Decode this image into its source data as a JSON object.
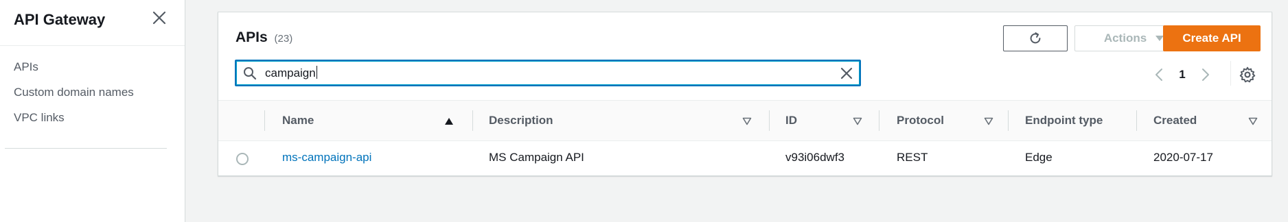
{
  "sidebar": {
    "title": "API Gateway",
    "items": [
      {
        "label": "APIs"
      },
      {
        "label": "Custom domain names"
      },
      {
        "label": "VPC links"
      }
    ]
  },
  "panel": {
    "title": "APIs",
    "count": "(23)",
    "actions_label": "Actions",
    "create_label": "Create API"
  },
  "search": {
    "value": "campaign"
  },
  "pagination": {
    "current_page": "1"
  },
  "table": {
    "columns": [
      {
        "label": "Name",
        "sort": "ascending"
      },
      {
        "label": "Description",
        "sort": "none"
      },
      {
        "label": "ID",
        "sort": "none"
      },
      {
        "label": "Protocol",
        "sort": "none"
      },
      {
        "label": "Endpoint type",
        "sort": "none"
      },
      {
        "label": "Created",
        "sort": "none"
      }
    ],
    "rows": [
      {
        "name": "ms-campaign-api",
        "description": "MS Campaign API",
        "id": "v93i06dwf3",
        "protocol": "REST",
        "endpoint_type": "Edge",
        "created": "2020-07-17"
      }
    ]
  },
  "colors": {
    "accent": "#ec7211",
    "link": "#0073bb",
    "focus": "#0073bb"
  }
}
